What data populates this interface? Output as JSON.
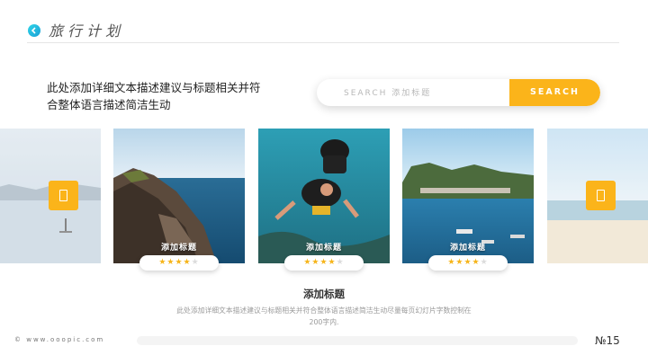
{
  "header": {
    "title": "旅行计划"
  },
  "intro": {
    "line1": "此处添加详细文本描述建议与标题相关并符",
    "line2": "合整体语言描述简洁生动"
  },
  "search": {
    "placeholder": "SEARCH  添加标题",
    "button_label": "SEARCH"
  },
  "cards": [
    {
      "caption": "添加标题",
      "stars": 4,
      "max_stars": 5,
      "scene": "coastal-cliff-sea"
    },
    {
      "caption": "添加标题",
      "stars": 4,
      "max_stars": 5,
      "scene": "scuba-divers-underwater"
    },
    {
      "caption": "添加标题",
      "stars": 4,
      "max_stars": 5,
      "scene": "harbor-island-boats"
    }
  ],
  "side_cards": [
    {
      "scene": "misty-lake-paddleboard"
    },
    {
      "scene": "sunny-beach-shore"
    }
  ],
  "bottom": {
    "title": "添加标题",
    "description_line1": "此处添加详细文本描述建议与标题相关并符合整体语言描述简洁生动尽量每页幻灯片字数控制在",
    "description_line2": "200字内."
  },
  "footer": {
    "website": "© www.ooopic.com",
    "page_number": "№15"
  },
  "colors": {
    "accent": "#fbb41a",
    "icon_teal": "#1fb6e0",
    "star": "#f6b51b"
  }
}
